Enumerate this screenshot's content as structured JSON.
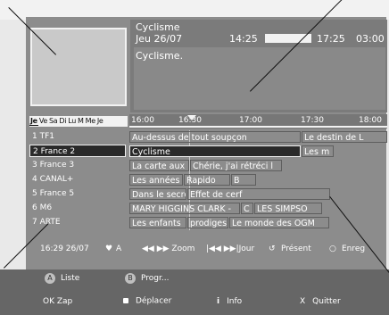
{
  "info": {
    "title": "Cyclisme",
    "date": "Jeu  26/07",
    "time_start": "14:25",
    "time_end": "17:25",
    "time_next": "03:00",
    "description": "Cyclisme."
  },
  "days": [
    "Je",
    "Ve",
    "Sa",
    "Di",
    "Lu",
    "M",
    "Me",
    "Je"
  ],
  "timeline": [
    "16:00",
    "16:30",
    "17:00",
    "17:30",
    "18:00"
  ],
  "channels": [
    "1  TF1",
    "2  France 2",
    "3  France 3",
    "4  CANAL+",
    "5  France 5",
    "6  M6",
    "7  ARTE"
  ],
  "programs": [
    [
      "Au-dessus de tout soupçon",
      "Le destin de L"
    ],
    [
      "Cyclisme",
      "Les m"
    ],
    [
      "La carte aux",
      "Chérie, j'ai rétréci l"
    ],
    [
      "Les années",
      "Rapido",
      "B"
    ],
    [
      "Dans le secret d",
      "Effet de cerf"
    ],
    [
      "MARY HIGGINS CLARK - ",
      "C",
      "LES SIMPSO"
    ],
    [
      "Les enfants",
      "prodiges",
      "Le monde des OGM"
    ]
  ],
  "status": {
    "datetime": "16:29  26/07",
    "heart": "♥",
    "a": "A",
    "zoom": "◀◀  ▶▶  Zoom",
    "jour": "|◀◀  ▶▶|Jour",
    "present": "Présent",
    "enreg": "Enreg"
  },
  "help": {
    "liste": "Liste",
    "liste_key": "A",
    "progr": "Progr...",
    "progr_key": "B",
    "zap": "OK Zap",
    "deplacer": "Déplacer",
    "info": "Info",
    "info_key": "i",
    "quitter": "Quitter",
    "quitter_key": "X"
  }
}
